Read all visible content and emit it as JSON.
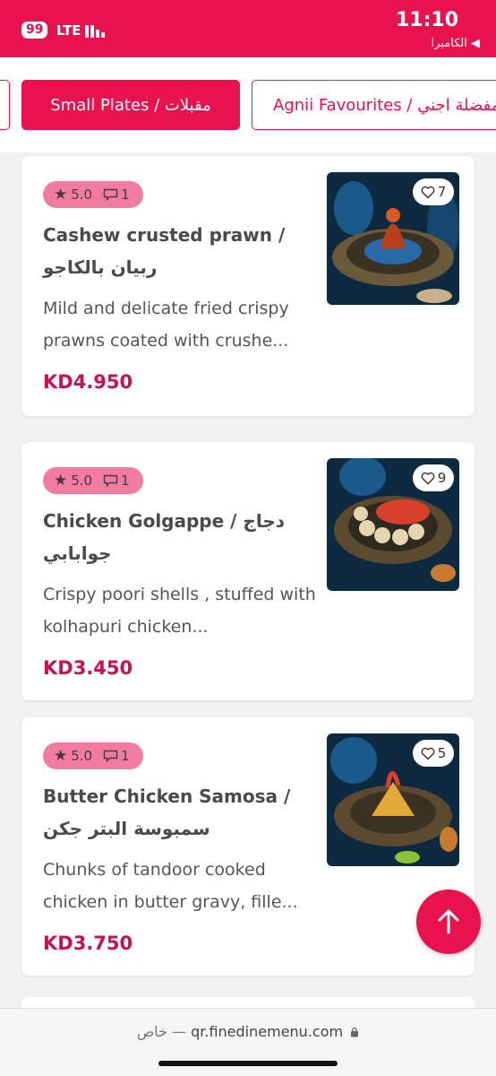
{
  "status_bar": {
    "battery": "99",
    "network": "LTE",
    "time": "11:10",
    "back_app": "◀ الكاميرا"
  },
  "categories": {
    "active": "Small Plates / مقبلات",
    "next": "Agnii Favourites / المفضلة اجني"
  },
  "items": [
    {
      "rating": "5.0",
      "comments": "1",
      "name": "Cashew crusted prawn / ربيان بالكاجو",
      "description": "Mild and delicate fried crispy prawns coated with crushe...",
      "price": "KD4.950",
      "likes": "7"
    },
    {
      "rating": "5.0",
      "comments": "1",
      "name": "Chicken Golgappe / دجاج جوابابي",
      "description": "Crispy poori shells , stuffed with kolhapuri chicken...",
      "price": "KD3.450",
      "likes": "9"
    },
    {
      "rating": "5.0",
      "comments": "1",
      "name": "Butter Chicken Samosa / سمبوسة البتر جكن",
      "description": "Chunks of tandoor cooked chicken in butter gravy, fille...",
      "price": "KD3.750",
      "likes": "5"
    }
  ],
  "url_bar": {
    "private_label": "خاص —",
    "url": "qr.finedinemenu.com"
  },
  "colors": {
    "brand": "#e8124f",
    "price": "#c8124f",
    "badge": "#f27ba0"
  },
  "icons": [
    "star-icon",
    "comment-icon",
    "heart-icon",
    "arrow-up-icon",
    "lock-icon",
    "signal-icon"
  ]
}
